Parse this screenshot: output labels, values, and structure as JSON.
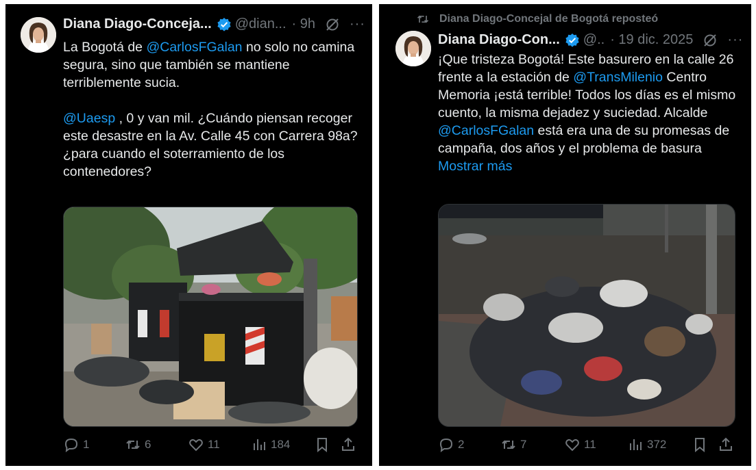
{
  "left_post": {
    "author_name": "Diana Diago-Conceja...",
    "handle": "@dian...",
    "time": "· 9h",
    "text": {
      "p1_before": "La Bogotá de ",
      "p1_mention": "@CarlosFGalan",
      "p1_after": " no solo no camina segura, sino que también se mantiene terriblemente sucia.",
      "p2_mention": "@Uaesp",
      "p2_after": " , 0 y van mil. ¿Cuándo piensan recoger este desastre en la Av. Calle 45 con Carrera 98a?",
      "p3": "¿para cuando el soterramiento de los contenedores?"
    },
    "actions": {
      "replies": "1",
      "reposts": "6",
      "likes": "11",
      "views": "184"
    }
  },
  "right_post": {
    "repost_label": "Diana Diago-Concejal de Bogotá reposteó",
    "author_name": "Diana Diago-Con...",
    "handle": "@..",
    "time": "· 19 dic. 2025",
    "text": {
      "before1": "¡Que tristeza Bogotá! Este basurero en la calle 26 frente a la estación de ",
      "mention1": "@TransMilenio",
      "middle": " Centro Memoria ¡está terrible! Todos los días es el mismo cuento, la misma dejadez y suciedad. Alcalde ",
      "mention2": "@CarlosFGalan",
      "after": "  está era una de su promesas de campaña, dos años y el problema de basura",
      "show_more": "Mostrar más"
    },
    "actions": {
      "replies": "2",
      "reposts": "7",
      "likes": "11",
      "views": "372"
    }
  },
  "more_glyph": "···",
  "colors": {
    "background": "#000000",
    "text": "#e7e9ea",
    "secondary": "#71767b",
    "link": "#1d9bf0",
    "verified": "#1d9bf0"
  }
}
